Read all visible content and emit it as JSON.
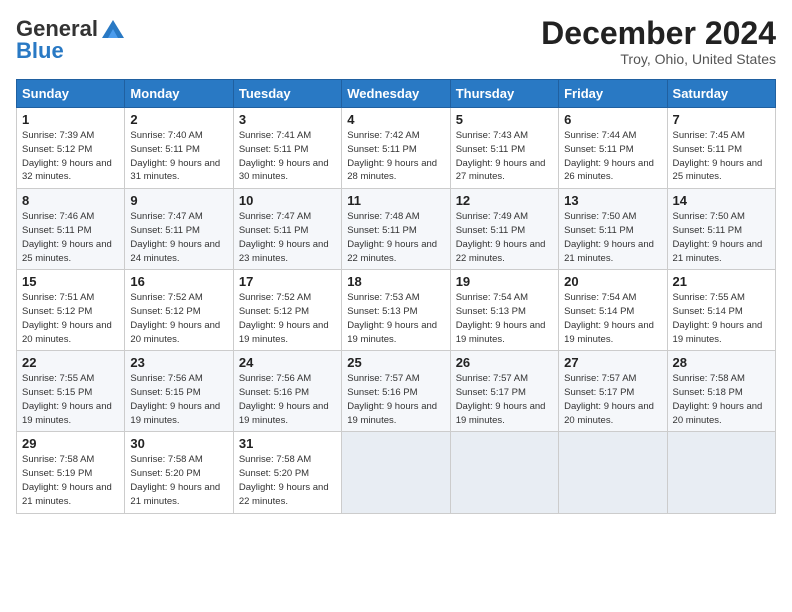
{
  "header": {
    "logo_line1": "General",
    "logo_line2": "Blue",
    "month": "December 2024",
    "location": "Troy, Ohio, United States"
  },
  "days_of_week": [
    "Sunday",
    "Monday",
    "Tuesday",
    "Wednesday",
    "Thursday",
    "Friday",
    "Saturday"
  ],
  "weeks": [
    [
      {
        "day": "1",
        "sunrise": "Sunrise: 7:39 AM",
        "sunset": "Sunset: 5:12 PM",
        "daylight": "Daylight: 9 hours and 32 minutes."
      },
      {
        "day": "2",
        "sunrise": "Sunrise: 7:40 AM",
        "sunset": "Sunset: 5:11 PM",
        "daylight": "Daylight: 9 hours and 31 minutes."
      },
      {
        "day": "3",
        "sunrise": "Sunrise: 7:41 AM",
        "sunset": "Sunset: 5:11 PM",
        "daylight": "Daylight: 9 hours and 30 minutes."
      },
      {
        "day": "4",
        "sunrise": "Sunrise: 7:42 AM",
        "sunset": "Sunset: 5:11 PM",
        "daylight": "Daylight: 9 hours and 28 minutes."
      },
      {
        "day": "5",
        "sunrise": "Sunrise: 7:43 AM",
        "sunset": "Sunset: 5:11 PM",
        "daylight": "Daylight: 9 hours and 27 minutes."
      },
      {
        "day": "6",
        "sunrise": "Sunrise: 7:44 AM",
        "sunset": "Sunset: 5:11 PM",
        "daylight": "Daylight: 9 hours and 26 minutes."
      },
      {
        "day": "7",
        "sunrise": "Sunrise: 7:45 AM",
        "sunset": "Sunset: 5:11 PM",
        "daylight": "Daylight: 9 hours and 25 minutes."
      }
    ],
    [
      {
        "day": "8",
        "sunrise": "Sunrise: 7:46 AM",
        "sunset": "Sunset: 5:11 PM",
        "daylight": "Daylight: 9 hours and 25 minutes."
      },
      {
        "day": "9",
        "sunrise": "Sunrise: 7:47 AM",
        "sunset": "Sunset: 5:11 PM",
        "daylight": "Daylight: 9 hours and 24 minutes."
      },
      {
        "day": "10",
        "sunrise": "Sunrise: 7:47 AM",
        "sunset": "Sunset: 5:11 PM",
        "daylight": "Daylight: 9 hours and 23 minutes."
      },
      {
        "day": "11",
        "sunrise": "Sunrise: 7:48 AM",
        "sunset": "Sunset: 5:11 PM",
        "daylight": "Daylight: 9 hours and 22 minutes."
      },
      {
        "day": "12",
        "sunrise": "Sunrise: 7:49 AM",
        "sunset": "Sunset: 5:11 PM",
        "daylight": "Daylight: 9 hours and 22 minutes."
      },
      {
        "day": "13",
        "sunrise": "Sunrise: 7:50 AM",
        "sunset": "Sunset: 5:11 PM",
        "daylight": "Daylight: 9 hours and 21 minutes."
      },
      {
        "day": "14",
        "sunrise": "Sunrise: 7:50 AM",
        "sunset": "Sunset: 5:11 PM",
        "daylight": "Daylight: 9 hours and 21 minutes."
      }
    ],
    [
      {
        "day": "15",
        "sunrise": "Sunrise: 7:51 AM",
        "sunset": "Sunset: 5:12 PM",
        "daylight": "Daylight: 9 hours and 20 minutes."
      },
      {
        "day": "16",
        "sunrise": "Sunrise: 7:52 AM",
        "sunset": "Sunset: 5:12 PM",
        "daylight": "Daylight: 9 hours and 20 minutes."
      },
      {
        "day": "17",
        "sunrise": "Sunrise: 7:52 AM",
        "sunset": "Sunset: 5:12 PM",
        "daylight": "Daylight: 9 hours and 19 minutes."
      },
      {
        "day": "18",
        "sunrise": "Sunrise: 7:53 AM",
        "sunset": "Sunset: 5:13 PM",
        "daylight": "Daylight: 9 hours and 19 minutes."
      },
      {
        "day": "19",
        "sunrise": "Sunrise: 7:54 AM",
        "sunset": "Sunset: 5:13 PM",
        "daylight": "Daylight: 9 hours and 19 minutes."
      },
      {
        "day": "20",
        "sunrise": "Sunrise: 7:54 AM",
        "sunset": "Sunset: 5:14 PM",
        "daylight": "Daylight: 9 hours and 19 minutes."
      },
      {
        "day": "21",
        "sunrise": "Sunrise: 7:55 AM",
        "sunset": "Sunset: 5:14 PM",
        "daylight": "Daylight: 9 hours and 19 minutes."
      }
    ],
    [
      {
        "day": "22",
        "sunrise": "Sunrise: 7:55 AM",
        "sunset": "Sunset: 5:15 PM",
        "daylight": "Daylight: 9 hours and 19 minutes."
      },
      {
        "day": "23",
        "sunrise": "Sunrise: 7:56 AM",
        "sunset": "Sunset: 5:15 PM",
        "daylight": "Daylight: 9 hours and 19 minutes."
      },
      {
        "day": "24",
        "sunrise": "Sunrise: 7:56 AM",
        "sunset": "Sunset: 5:16 PM",
        "daylight": "Daylight: 9 hours and 19 minutes."
      },
      {
        "day": "25",
        "sunrise": "Sunrise: 7:57 AM",
        "sunset": "Sunset: 5:16 PM",
        "daylight": "Daylight: 9 hours and 19 minutes."
      },
      {
        "day": "26",
        "sunrise": "Sunrise: 7:57 AM",
        "sunset": "Sunset: 5:17 PM",
        "daylight": "Daylight: 9 hours and 19 minutes."
      },
      {
        "day": "27",
        "sunrise": "Sunrise: 7:57 AM",
        "sunset": "Sunset: 5:17 PM",
        "daylight": "Daylight: 9 hours and 20 minutes."
      },
      {
        "day": "28",
        "sunrise": "Sunrise: 7:58 AM",
        "sunset": "Sunset: 5:18 PM",
        "daylight": "Daylight: 9 hours and 20 minutes."
      }
    ],
    [
      {
        "day": "29",
        "sunrise": "Sunrise: 7:58 AM",
        "sunset": "Sunset: 5:19 PM",
        "daylight": "Daylight: 9 hours and 21 minutes."
      },
      {
        "day": "30",
        "sunrise": "Sunrise: 7:58 AM",
        "sunset": "Sunset: 5:20 PM",
        "daylight": "Daylight: 9 hours and 21 minutes."
      },
      {
        "day": "31",
        "sunrise": "Sunrise: 7:58 AM",
        "sunset": "Sunset: 5:20 PM",
        "daylight": "Daylight: 9 hours and 22 minutes."
      },
      null,
      null,
      null,
      null
    ]
  ]
}
